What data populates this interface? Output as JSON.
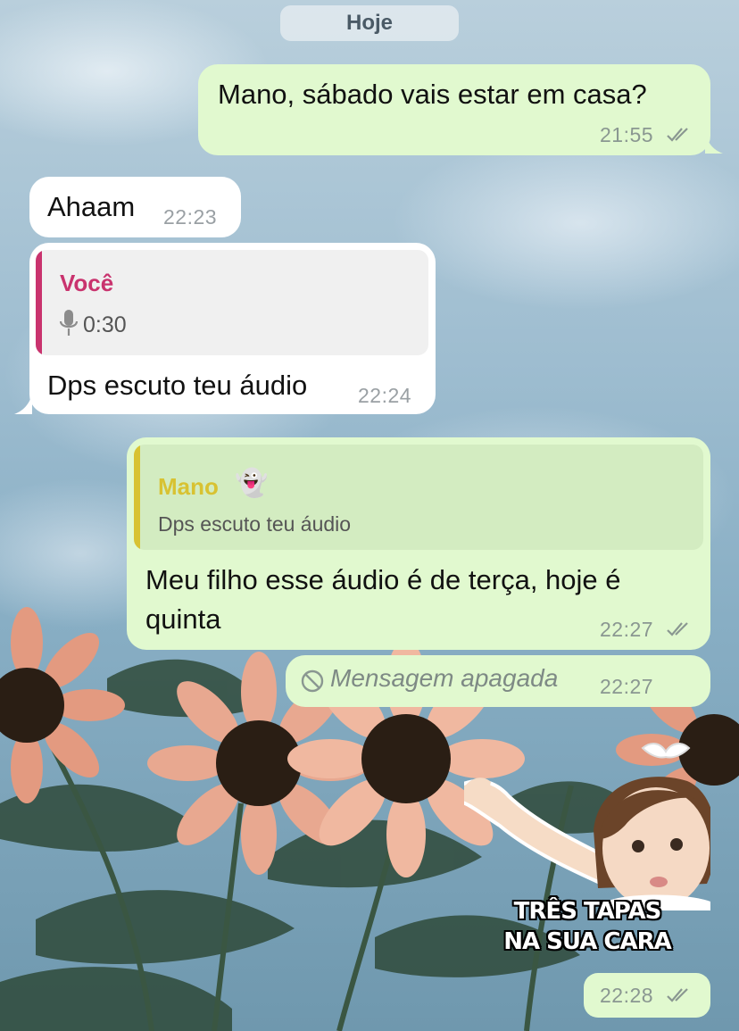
{
  "chat": {
    "date_label": "Hoje",
    "messages": [
      {
        "text": "Mano, sábado vais estar em casa?",
        "time": "21:55"
      },
      {
        "text": "Ahaam",
        "time": "22:23"
      },
      {
        "quote_name": "Você",
        "quote_audio": "0:30",
        "text": "Dps escuto teu áudio",
        "time": "22:24"
      },
      {
        "quote_name": "Mano",
        "quote_emoji": "👻",
        "quote_text": "Dps escuto teu áudio",
        "text_line1": "Meu filho esse áudio é de terça, hoje é",
        "text_line2": "quinta",
        "time": "22:27"
      },
      {
        "text": "Mensagem apagada",
        "time": "22:27"
      },
      {
        "sticker_line1": "TRÊS TAPAS",
        "sticker_line2": "NA SUA CARA",
        "time": "22:28"
      }
    ]
  },
  "colors": {
    "outgoing_bubble": "#e1f9cf",
    "incoming_bubble": "#ffffff",
    "voce_accent": "#c9336e",
    "mano_accent": "#d8c232",
    "tick_color": "#8a9791"
  },
  "icons": [
    "double-check-icon",
    "microphone-icon",
    "deleted-message-icon",
    "ghost-emoji"
  ]
}
